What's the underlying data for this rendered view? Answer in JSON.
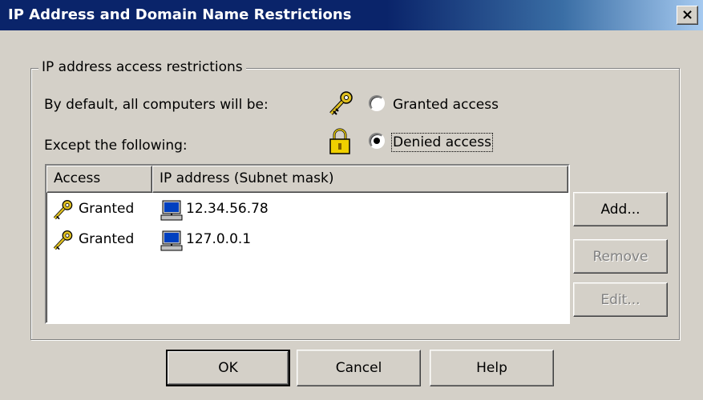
{
  "window": {
    "title": "IP Address and Domain Name Restrictions",
    "close_label": "×"
  },
  "group": {
    "legend": "IP address access restrictions",
    "default_label": "By default, all computers will be:",
    "except_label": "Except the following:",
    "radio_granted": {
      "label": "Granted access",
      "checked": false
    },
    "radio_denied": {
      "label": "Denied access",
      "checked": true
    }
  },
  "list": {
    "columns": [
      "Access",
      "IP address (Subnet mask)"
    ],
    "rows": [
      {
        "access": "Granted",
        "ip": "12.34.56.78",
        "icon": "key-icon"
      },
      {
        "access": "Granted",
        "ip": "127.0.0.1",
        "icon": "key-icon"
      }
    ]
  },
  "side_buttons": {
    "add": "Add...",
    "remove": "Remove",
    "edit": "Edit..."
  },
  "bottom_buttons": {
    "ok": "OK",
    "cancel": "Cancel",
    "help": "Help"
  },
  "colors": {
    "title_bar": "#0a246a",
    "face": "#d4d0c8",
    "key_gold": "#e0c020",
    "lock_gold": "#f0d000"
  }
}
